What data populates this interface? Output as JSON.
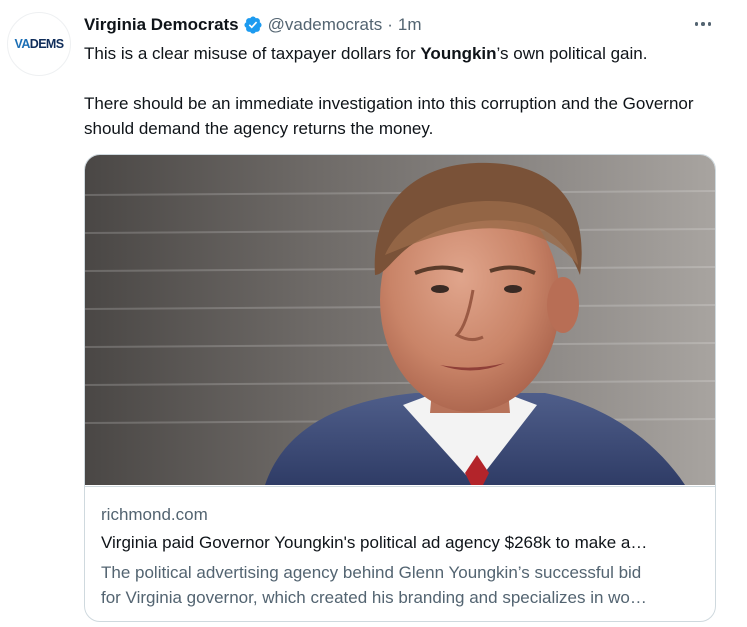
{
  "account": {
    "avatar_text_a": "VA",
    "avatar_text_b": "DEMS",
    "name": "Virginia Democrats",
    "handle": "@vademocrats",
    "separator": "·",
    "time": "1m"
  },
  "tweet": {
    "line1_before": "This is a clear misuse of taxpayer dollars for ",
    "line1_bold": "Youngkin",
    "line1_after": "’s own political gain.",
    "paragraph2": "There should be an immediate investigation into this corruption and the Governor should demand the agency returns the money."
  },
  "card": {
    "domain": "richmond.com",
    "title": "Virginia paid Governor Youngkin's political ad agency $268k to make a…",
    "description_line1": "The political advertising agency behind Glenn Youngkin’s successful bid",
    "description_line2": "for Virginia governor, which created his branding and specializes in wo…"
  },
  "icons": {
    "verified": "verified-badge-icon",
    "more": "more-options-icon"
  },
  "colors": {
    "verified_blue": "#1d9bf0",
    "text_primary": "#0f1419",
    "text_secondary": "#536471",
    "card_border": "#cfd9de"
  }
}
